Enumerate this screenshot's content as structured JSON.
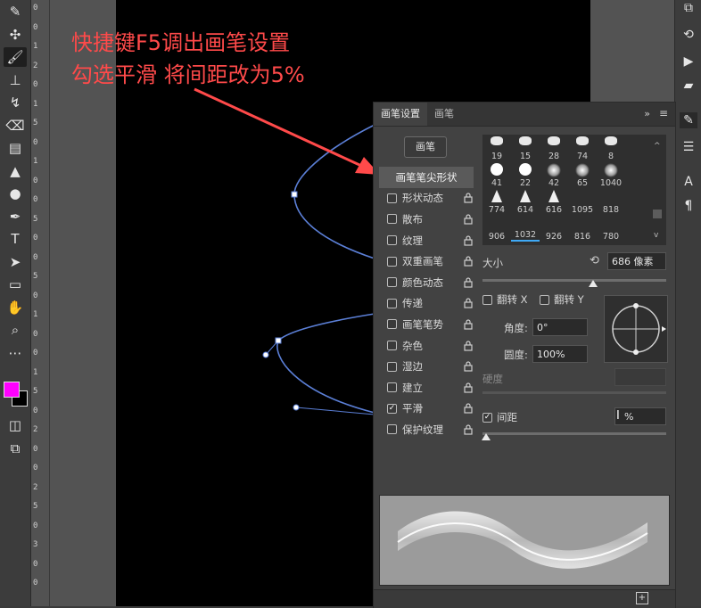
{
  "annotation": {
    "line1": "快捷键F5调出画笔设置",
    "line2": "勾选平滑 将间距改为5%"
  },
  "colors": {
    "annotation": "#ff4a4a",
    "path": "#5b7fd6",
    "foreground_swatch": "#ff00ff",
    "background_swatch": "#000000"
  },
  "ruler": {
    "labels": [
      "0",
      "0",
      "1",
      "2",
      "0",
      "1",
      "5",
      "0",
      "1",
      "0",
      "0",
      "5",
      "0",
      "0",
      "5",
      "0",
      "1",
      "0",
      "0",
      "1",
      "5",
      "0",
      "2",
      "0",
      "0",
      "2",
      "5",
      "0",
      "3",
      "0",
      "0"
    ]
  },
  "toolbar": {
    "tools": [
      {
        "name": "eyedropper-tool",
        "glyph": "✎"
      },
      {
        "name": "healing-tool",
        "glyph": "✣"
      },
      {
        "name": "brush-tool",
        "glyph": "🖌"
      },
      {
        "name": "stamp-tool",
        "glyph": "⊥"
      },
      {
        "name": "history-brush-tool",
        "glyph": "↯"
      },
      {
        "name": "eraser-tool",
        "glyph": "⌫"
      },
      {
        "name": "gradient-tool",
        "glyph": "▤"
      },
      {
        "name": "blur-tool",
        "glyph": "▲"
      },
      {
        "name": "dodge-tool",
        "glyph": "●"
      },
      {
        "name": "pen-tool",
        "glyph": "✒"
      },
      {
        "name": "type-tool",
        "glyph": "T"
      },
      {
        "name": "path-selection-tool",
        "glyph": "➤"
      },
      {
        "name": "shape-tool",
        "glyph": "▭"
      },
      {
        "name": "hand-tool",
        "glyph": "✋"
      },
      {
        "name": "zoom-tool",
        "glyph": "⌕"
      },
      {
        "name": "more-tools",
        "glyph": "⋯"
      }
    ]
  },
  "brush_panel": {
    "tabs": [
      "画笔设置",
      "画笔"
    ],
    "brush_button": "画笔",
    "options": [
      {
        "label": "画笔笔尖形状",
        "header": true
      },
      {
        "label": "形状动态",
        "checked": false
      },
      {
        "label": "散布",
        "checked": false
      },
      {
        "label": "纹理",
        "checked": false
      },
      {
        "label": "双重画笔",
        "checked": false
      },
      {
        "label": "颜色动态",
        "checked": false
      },
      {
        "label": "传递",
        "checked": false
      },
      {
        "label": "画笔笔势",
        "checked": false
      },
      {
        "label": "杂色",
        "checked": false
      },
      {
        "label": "湿边",
        "checked": false
      },
      {
        "label": "建立",
        "checked": false
      },
      {
        "label": "平滑",
        "checked": true
      },
      {
        "label": "保护纹理",
        "checked": false
      }
    ],
    "brush_sizes": [
      [
        "19",
        "15",
        "28",
        "74",
        "8"
      ],
      [
        "41",
        "22",
        "42",
        "65",
        "1040"
      ],
      [
        "774",
        "614",
        "616",
        "1095",
        "818"
      ],
      [
        "906",
        "1032",
        "926",
        "816",
        "780"
      ]
    ],
    "size_label": "大小",
    "size_value": "686 像素",
    "size_fraction": 0.6,
    "flip_x": "翻转 X",
    "flip_y": "翻转 Y",
    "angle_label": "角度:",
    "angle_value": "0°",
    "roundness_label": "圆度:",
    "roundness_value": "100%",
    "hardness_label": "硬度",
    "spacing_label": "间距",
    "spacing_checked": true,
    "spacing_value": "%",
    "spacing_fraction": 0.0
  }
}
